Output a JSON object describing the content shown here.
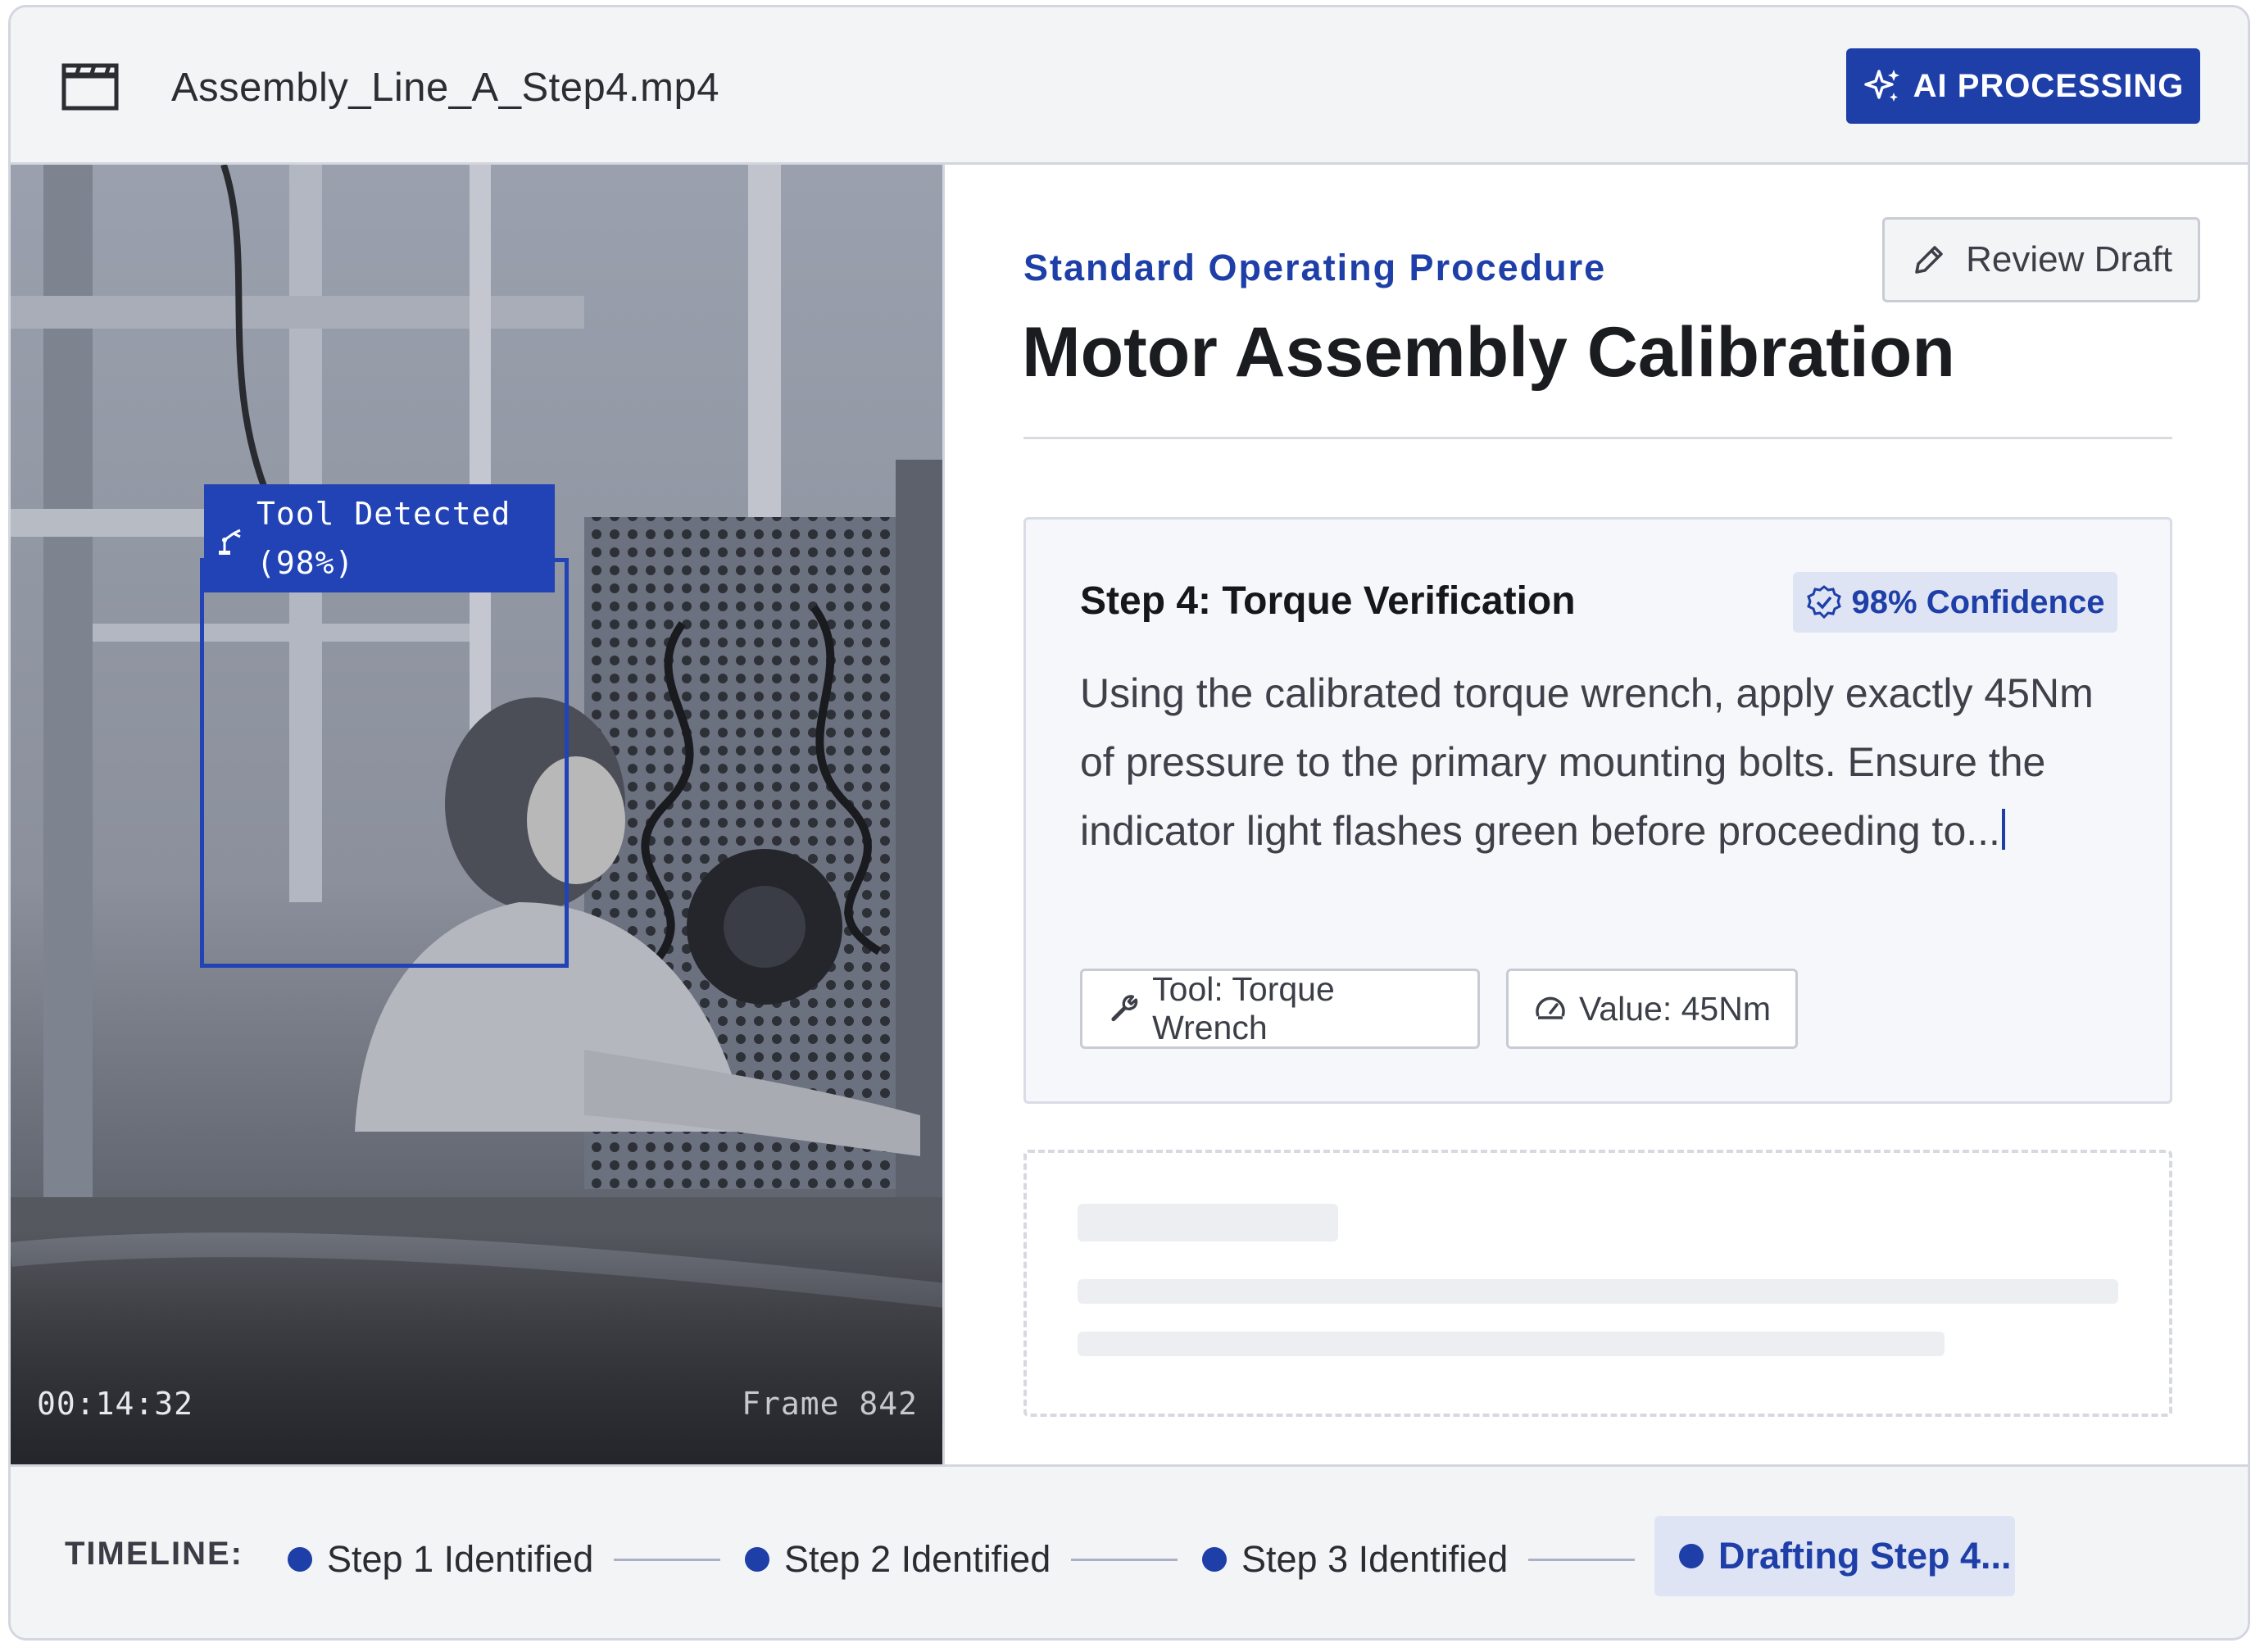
{
  "header": {
    "file_icon": "clapperboard-icon",
    "file_name": "Assembly_Line_A_Step4.mp4",
    "ai_button": {
      "icon": "sparkles-icon",
      "label": "AI PROCESSING"
    }
  },
  "video": {
    "detection": {
      "icon": "robot-arm-icon",
      "line1": "Tool Detected",
      "line2": "(98%)"
    },
    "timecode": "00:14:32",
    "frame": "Frame 842"
  },
  "document": {
    "section_label": "Standard Operating Procedure",
    "review_button": {
      "icon": "pencil-icon",
      "label": "Review Draft"
    },
    "title": "Motor Assembly Calibration",
    "step": {
      "title": "Step 4: Torque Verification",
      "confidence": {
        "icon": "verified-badge-icon",
        "label": "98% Confidence"
      },
      "text": "Using the calibrated torque wrench, apply exactly 45Nm of pressure to the primary mounting bolts. Ensure the indicator light flashes green before proceeding to...",
      "chips": [
        {
          "icon": "wrench-icon",
          "label": "Tool: Torque Wrench"
        },
        {
          "icon": "gauge-icon",
          "label": "Value: 45Nm"
        }
      ]
    }
  },
  "timeline": {
    "label": "TIMELINE:",
    "steps": [
      {
        "label": "Step 1 Identified"
      },
      {
        "label": "Step 2 Identified"
      },
      {
        "label": "Step 3 Identified"
      }
    ],
    "active": {
      "label": "Drafting Step 4..."
    }
  },
  "colors": {
    "accent": "#1e3fa8",
    "accent_light": "#dfe4f5",
    "panel_bg": "#f3f4f6",
    "border": "#d3d6df"
  }
}
